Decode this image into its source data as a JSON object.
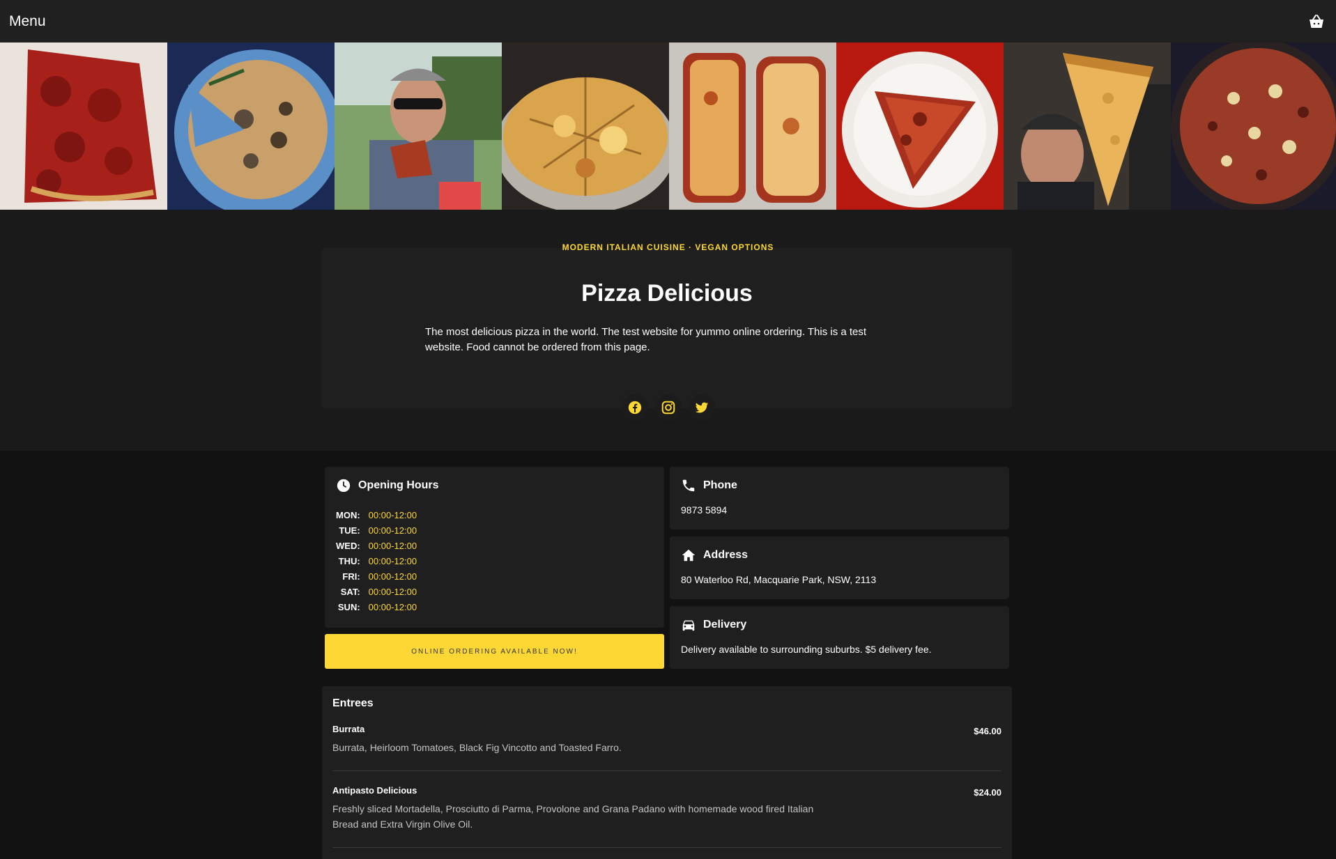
{
  "header": {
    "menu_label": "Menu",
    "cart_icon": "shopping-basket-icon"
  },
  "photos": [
    {
      "subject": "pepperoni-square-slice"
    },
    {
      "subject": "mushroom-pizza-on-blue-plate"
    },
    {
      "subject": "man-with-sunglasses-holding-slice"
    },
    {
      "subject": "cheese-pizza-on-tray"
    },
    {
      "subject": "cheese-bread-slices-on-foil"
    },
    {
      "subject": "deep-dish-slice-on-plate"
    },
    {
      "subject": "man-holding-giant-slice"
    },
    {
      "subject": "pan-pizza-with-toppings"
    }
  ],
  "hero": {
    "tagline": "MODERN ITALIAN CUISINE · VEGAN OPTIONS",
    "title": "Pizza Delicious",
    "description": "The most delicious pizza in the world. The test website for yummo online ordering. This is a test website. Food cannot be ordered from this page.",
    "socials": [
      "facebook-icon",
      "instagram-icon",
      "twitter-icon"
    ]
  },
  "hours": {
    "title": "Opening Hours",
    "rows": [
      {
        "day": "MON:",
        "time": "00:00-12:00"
      },
      {
        "day": "TUE:",
        "time": "00:00-12:00"
      },
      {
        "day": "WED:",
        "time": "00:00-12:00"
      },
      {
        "day": "THU:",
        "time": "00:00-12:00"
      },
      {
        "day": "FRI:",
        "time": "00:00-12:00"
      },
      {
        "day": "SAT:",
        "time": "00:00-12:00"
      },
      {
        "day": "SUN:",
        "time": "00:00-12:00"
      }
    ]
  },
  "order_button": "ONLINE ORDERING AVAILABLE NOW!",
  "phone": {
    "title": "Phone",
    "value": "9873 5894"
  },
  "address": {
    "title": "Address",
    "value": "80 Waterloo Rd, Macquarie Park, NSW, 2113"
  },
  "delivery": {
    "title": "Delivery",
    "value": "Delivery available to surrounding suburbs. $5 delivery fee."
  },
  "menu": {
    "section_title": "Entrees",
    "items": [
      {
        "name": "Burrata",
        "description": "Burrata, Heirloom Tomatoes, Black Fig Vincotto and Toasted Farro.",
        "price": "$46.00"
      },
      {
        "name": "Antipasto Delicious",
        "description": "Freshly sliced Mortadella, Prosciutto di Parma, Provolone and Grana Padano with homemade wood fired Italian Bread and Extra Virgin Olive Oil.",
        "price": "$24.00"
      }
    ]
  },
  "colors": {
    "accent": "#fdd835",
    "topbar": "#202020",
    "panel": "#1f1f1f",
    "page": "#121212"
  }
}
